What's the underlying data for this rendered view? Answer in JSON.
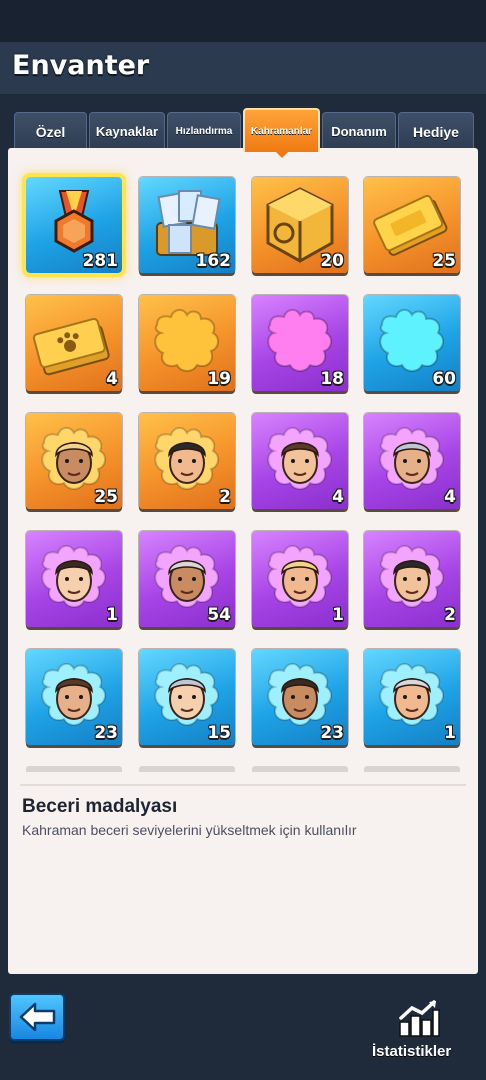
{
  "header": {
    "title": "Envanter"
  },
  "tabs": [
    {
      "label": "Özel",
      "active": false
    },
    {
      "label": "Kaynaklar",
      "active": false
    },
    {
      "label": "Hızlandırma",
      "active": false
    },
    {
      "label": "Kahramanlar",
      "active": true
    },
    {
      "label": "Donanım",
      "active": false
    },
    {
      "label": "Hediye",
      "active": false
    }
  ],
  "items": [
    {
      "icon": "skill-medal-icon",
      "count": "281",
      "bg": "blue",
      "selected": true
    },
    {
      "icon": "hero-cards-chest-icon",
      "count": "162",
      "bg": "blue"
    },
    {
      "icon": "golden-cube-chest-icon",
      "count": "20",
      "bg": "orange"
    },
    {
      "icon": "gold-ticket-icon",
      "count": "25",
      "bg": "orange"
    },
    {
      "icon": "paw-ticket-icon",
      "count": "4",
      "bg": "orange"
    },
    {
      "icon": "orange-puzzle-piece-icon",
      "count": "19",
      "bg": "orange"
    },
    {
      "icon": "purple-puzzle-piece-icon",
      "count": "18",
      "bg": "purple"
    },
    {
      "icon": "blue-puzzle-piece-icon",
      "count": "60",
      "bg": "blue"
    },
    {
      "icon": "hero-shard-curly-hair-icon",
      "count": "25",
      "bg": "orange"
    },
    {
      "icon": "hero-shard-old-bearded-icon",
      "count": "2",
      "bg": "orange"
    },
    {
      "icon": "hero-shard-blonde-woman-icon",
      "count": "4",
      "bg": "purple"
    },
    {
      "icon": "hero-shard-beanie-man-icon",
      "count": "4",
      "bg": "purple"
    },
    {
      "icon": "hero-shard-police-cap-icon",
      "count": "1",
      "bg": "purple"
    },
    {
      "icon": "hero-shard-cowboy-hat-icon",
      "count": "54",
      "bg": "purple"
    },
    {
      "icon": "hero-shard-dreadlocks-icon",
      "count": "1",
      "bg": "purple"
    },
    {
      "icon": "hero-shard-silver-hair-woman-icon",
      "count": "2",
      "bg": "purple"
    },
    {
      "icon": "hero-shard-young-cap-icon",
      "count": "23",
      "bg": "blue"
    },
    {
      "icon": "hero-shard-soldier-helmet-icon",
      "count": "15",
      "bg": "blue"
    },
    {
      "icon": "hero-shard-mohawk-icon",
      "count": "23",
      "bg": "blue"
    },
    {
      "icon": "hero-shard-gas-mask-icon",
      "count": "1",
      "bg": "blue"
    }
  ],
  "description": {
    "title": "Beceri madalyası",
    "text": "Kahraman beceri seviyelerini yükseltmek için kullanılır"
  },
  "footer": {
    "stats_label": "İstatistikler"
  },
  "colors": {
    "accent": "#f28a1c",
    "tab_bg": "#2e3d52",
    "panel_bg": "#f7f1ef",
    "back_button": "#2aa3f0"
  }
}
